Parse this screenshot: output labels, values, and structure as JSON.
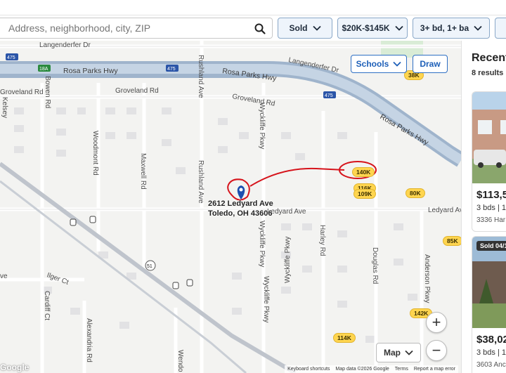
{
  "search": {
    "placeholder": "Address, neighborhood, city, ZIP"
  },
  "filters": {
    "sold": "Sold",
    "price": "$20K-$145K",
    "beds_baths": "3+ bd, 1+ ba"
  },
  "map_controls": {
    "schools": "Schools",
    "draw": "Draw",
    "map_type": "Map",
    "zoom_in": "+",
    "zoom_out": "−"
  },
  "roads": {
    "langenderfer_1": "Langenderfer Dr",
    "langenderfer_2": "Langenderfer Dr",
    "rosa_parks_1": "Rosa Parks Hwy",
    "rosa_parks_2": "Rosa Parks Hwy",
    "rosa_parks_3": "Rosa Parks Hwy",
    "groveland_1": "Groveland Rd",
    "groveland_2": "Groveland Rd",
    "groveland_3": "Groveland Rd",
    "bowen": "Bowen Rd",
    "woodmont": "Woodmont Rd",
    "maxwell": "Maxwell Rd",
    "rushland_1": "Rushland Ave",
    "rushland_2": "Rushland Ave",
    "wyckliffe_1": "Wyckliffe Pkwy",
    "wyckliffe_2": "Wyckliffe Pkwy",
    "wyckliffe_3": "Wyckliffe Pkwy",
    "wyckliffe_4": "Wyckliffe Pkwy",
    "ledyard_1": "Ledyard Ave",
    "ledyard_2": "Ledyard Ave",
    "harley": "Harley Rd",
    "douglas": "Douglas Rd",
    "anderson": "Anderson Pkwy",
    "ilger": "Ilger Ct",
    "cardiff": "Cardiff Ct",
    "alexandria": "Alexandria Rd",
    "wendover": "Wendo",
    "kelsey": "Kelsey",
    "ave_left": "ve",
    "shield_475a": "475",
    "shield_18a": "18A",
    "shield_475b": "475",
    "shield_475c": "475",
    "shield_51": "51"
  },
  "price_pins": [
    "38K",
    "140K",
    "116K",
    "109K",
    "80K",
    "85K",
    "142K",
    "114K"
  ],
  "selected_address": {
    "line1": "2612 Ledyard Ave",
    "line2": "Toledo, OH 43606"
  },
  "attribution": {
    "logo": "Google",
    "shortcuts": "Keyboard shortcuts",
    "mapdata": "Map data ©2026 Google",
    "terms": "Terms",
    "report": "Report a map error"
  },
  "sidebar": {
    "title": "Recently sold",
    "count": "8 results",
    "cards": [
      {
        "price": "$113,5",
        "details": "3 bds | 1",
        "street": "3336 Har",
        "badge": ""
      },
      {
        "price": "$38,02",
        "details": "3 bds | 1",
        "street": "3603 Anc",
        "badge": "Sold 04/1"
      }
    ]
  },
  "colors": {
    "accent": "#1d5fb8",
    "price_pin": "#ffd54f",
    "highway": "#9fb4cc",
    "annotation": "#d6131b"
  }
}
